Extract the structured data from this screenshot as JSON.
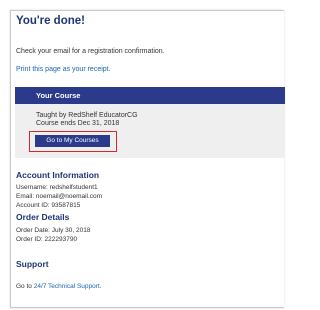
{
  "header": {
    "title": "You're done!"
  },
  "intro": {
    "check_email": "Check your email for a registration confirmation.",
    "print_link": "Print this page as your receipt."
  },
  "course": {
    "heading": "Your Course",
    "taught_by": "Taught by RedShelf EducatorCG",
    "ends": "Course ends Dec 31, 2018",
    "button_label": "Go to My Courses"
  },
  "account": {
    "heading": "Account Information",
    "username": "Username: redshelfstudent1",
    "email": "Email: noemail@noemail.com",
    "account_id": "Account ID: 93587815"
  },
  "order": {
    "heading": "Order Details",
    "date": "Order Date: July 30, 2018",
    "order_id": "Order ID: 222293790"
  },
  "support": {
    "heading": "Support",
    "prefix": "Go to",
    "link": "24/7 Technical Support",
    "suffix": "."
  },
  "colors": {
    "navy": "#2b3a8a",
    "title_blue": "#1f3577",
    "link_blue": "#1d62b3",
    "highlight_red": "#d9252b",
    "course_bg": "#efefef"
  }
}
